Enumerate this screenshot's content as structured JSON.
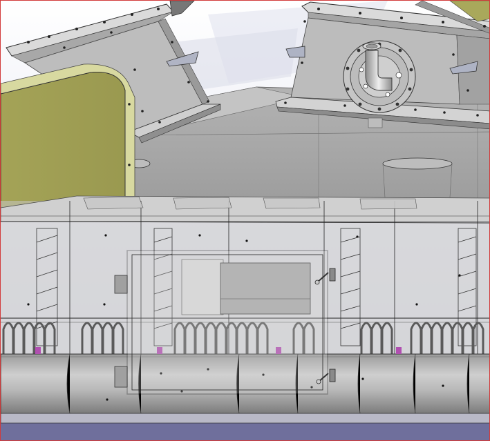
{
  "view": {
    "kind": "cad-3d-viewport",
    "frame_color": "#d23a3a",
    "colors": {
      "sky": "#f1f2f8",
      "steel": "#c8c8c8",
      "steel_dark": "#8a8a8a",
      "yellow_panel": "#a9a85b",
      "yellow_edge": "#d8d9a0",
      "floor": "#6f6f9c",
      "marker": "#b04fb0",
      "line": "#222222"
    },
    "icons": [
      "upper-left-hopper",
      "upper-right-hopper",
      "flanged-pipe-elbow",
      "yellow-guard-panel",
      "roller-drum",
      "inspection-door"
    ]
  }
}
